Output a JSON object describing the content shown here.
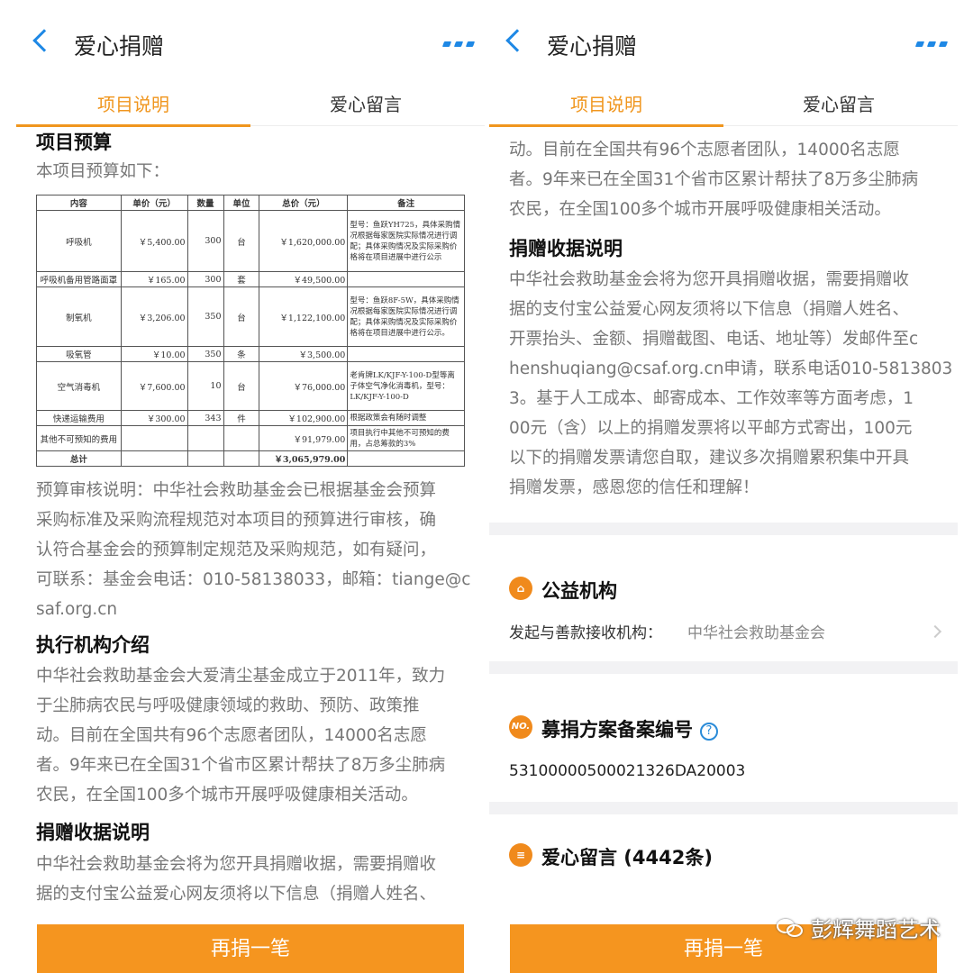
{
  "header": {
    "title": "爱心捐赠",
    "back_icon": "back-chevron-icon",
    "more_icon": "more-dots-icon"
  },
  "tabs": [
    {
      "label": "项目说明"
    },
    {
      "label": "爱心留言"
    }
  ],
  "colors": {
    "accent": "#f0961e",
    "link_blue": "#1e88e5",
    "button": "#f5951f"
  },
  "left": {
    "budget_title": "项目预算",
    "budget_intro": "本项目预算如下：",
    "table": {
      "headers": [
        "内容",
        "单价（元）",
        "数量",
        "单位",
        "总价（元）",
        "备注"
      ],
      "rows": [
        [
          "呼吸机",
          "￥5,400.00",
          "300",
          "台",
          "￥1,620,000.00",
          "型号：鱼跃YH725，具体采购情况根据每家医院实际情况进行调配；具体采购情况及实际采购价格将在项目进展中进行公示"
        ],
        [
          "呼吸机备用管路面罩",
          "￥165.00",
          "300",
          "套",
          "￥49,500.00",
          ""
        ],
        [
          "制氧机",
          "￥3,206.00",
          "350",
          "台",
          "￥1,122,100.00",
          "型号：鱼跃8F-5W，具体采购情况根据每家医院实际情况进行调配；具体采购情况及实际采购价格将在项目进展中进行公示。"
        ],
        [
          "吸氧管",
          "￥10.00",
          "350",
          "条",
          "￥3,500.00",
          ""
        ],
        [
          "空气消毒机",
          "￥7,600.00",
          "10",
          "台",
          "￥76,000.00",
          "老肯牌LK/KJF-Y-100-D型等离子体空气净化消毒机，型号：LK/KJF-Y-100-D"
        ],
        [
          "快递运输费用",
          "￥300.00",
          "343",
          "件",
          "￥102,900.00",
          "根据政策会有随时调整"
        ],
        [
          "其他不可预知的费用",
          "",
          "",
          "",
          "￥91,979.00",
          "项目执行中其他不可预知的费用，占总筹款的3%"
        ]
      ],
      "total_label": "总计",
      "total_value": "￥3,065,979.00"
    },
    "audit_text": [
      "预算审核说明：中华社会救助基金会已根据基金会预算",
      "采购标准及采购流程规范对本项目的预算进行审核，确",
      "认符合基金会的预算制定规范及采购规范，如有疑问，",
      "可联系：基金会电话：010-58138033，邮箱：tiange@c",
      "saf.org.cn"
    ],
    "org_title": "执行机构介绍",
    "org_text": [
      "中华社会救助基金会大爱清尘基金成立于2011年，致力",
      "于尘肺病农民与呼吸健康领域的救助、预防、政策推",
      "动。目前在全国共有96个志愿者团队，14000名志愿",
      "者。9年来已在全国31个省市区累计帮扶了8万多尘肺病",
      "农民，在全国100多个城市开展呼吸健康相关活动。"
    ],
    "receipt_title": "捐赠收据说明",
    "receipt_text": [
      "中华社会救助基金会将为您开具捐赠收据，需要捐赠收",
      "据的支付宝公益爱心网友须将以下信息（捐赠人姓名、"
    ],
    "button": "再捐一笔"
  },
  "right": {
    "top_text": [
      "动。目前在全国共有96个志愿者团队，14000名志愿",
      "者。9年来已在全国31个省市区累计帮扶了8万多尘肺病",
      "农民，在全国100多个城市开展呼吸健康相关活动。"
    ],
    "receipt_title": "捐赠收据说明",
    "receipt_text": [
      "中华社会救助基金会将为您开具捐赠收据，需要捐赠收",
      "据的支付宝公益爱心网友须将以下信息（捐赠人姓名、",
      "开票抬头、金额、捐赠截图、电话、地址等）发邮件至c",
      "henshuqiang@csaf.org.cn申请，联系电话010-5813803",
      "3。基于人工成本、邮寄成本、工作效率等方面考虑，1",
      "00元（含）以上的捐赠发票将以平邮方式寄出，100元",
      "以下的捐赠发票请您自取，建议多次捐赠累积集中开具",
      "捐赠发票，感恩您的信任和理解！"
    ],
    "org_section": {
      "title": "公益机构",
      "label": "发起与善款接收机构：",
      "value": "中华社会救助基金会",
      "icon": "institution-icon"
    },
    "filing_section": {
      "title": "募捐方案备案编号",
      "icon_text": "NO.",
      "number": "53100000500021326DA20003",
      "help": "?"
    },
    "messages_section": {
      "title": "爱心留言 (4442条)",
      "icon": "message-icon"
    },
    "button": "再捐一笔"
  },
  "watermark": "彭辉舞蹈艺术"
}
